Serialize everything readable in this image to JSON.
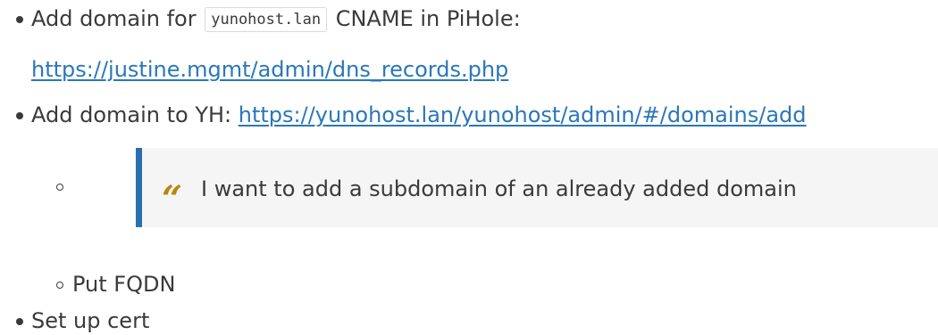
{
  "items": [
    {
      "prefix": "Add domain for ",
      "code": "yunohost.lan",
      "suffix": " CNAME in PiHole:",
      "link": "https://justine.mgmt/admin/dns_records.php"
    },
    {
      "prefix": "Add domain to YH: ",
      "link": "https://yunohost.lan/yunohost/admin/#/domains/add",
      "children": [
        {
          "quote": "I want to add a subdomain of an already added domain"
        },
        {
          "text": "Put FQDN"
        }
      ]
    },
    {
      "text": "Set up cert"
    }
  ],
  "colors": {
    "text": "#3a3a3a",
    "link": "#2a77b8",
    "quote_bar": "#2a6fad",
    "quote_bg": "#f5f5f5",
    "quote_mark": "#b8860b"
  },
  "icons": {
    "quote_mark": "“"
  }
}
